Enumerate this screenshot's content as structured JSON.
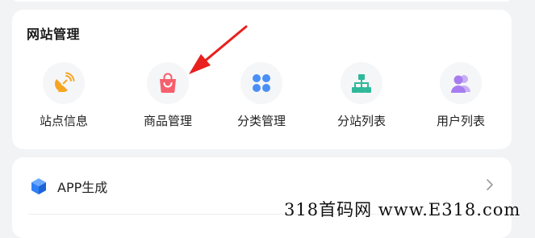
{
  "site_management": {
    "title": "网站管理",
    "items": [
      {
        "label": "站点信息",
        "icon": "satellite-dish-icon"
      },
      {
        "label": "商品管理",
        "icon": "shopping-bag-icon"
      },
      {
        "label": "分类管理",
        "icon": "four-dots-icon"
      },
      {
        "label": "分站列表",
        "icon": "sitemap-icon"
      },
      {
        "label": "用户列表",
        "icon": "users-icon"
      }
    ]
  },
  "app_section": {
    "label": "APP生成",
    "icon": "cube-icon"
  },
  "watermark": {
    "text": "318首码网 www.E318.com"
  },
  "colors": {
    "background": "#f2f3f5",
    "card": "#ffffff",
    "satellite_orange": "#f5a623",
    "bag_red": "#f4606c",
    "grid_blue": "#4a8ff5",
    "sitemap_green": "#2fb89a",
    "users_purple": "#a77cf0",
    "cube_blue": "#2f7ff5",
    "arrow_red": "#e8201e"
  }
}
